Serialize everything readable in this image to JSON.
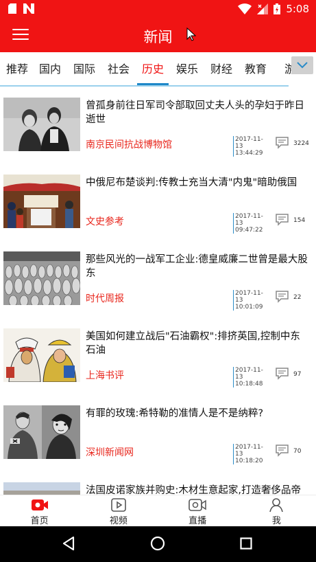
{
  "status_bar": {
    "time": "5:08",
    "icons": [
      "sd-card-icon",
      "notification-n-icon",
      "wifi-icon",
      "signal-icon",
      "battery-icon"
    ]
  },
  "app_bar": {
    "title": "新闻",
    "menu_icon": "hamburger-menu-icon"
  },
  "categories": {
    "items": [
      "推荐",
      "国内",
      "国际",
      "社会",
      "历史",
      "娱乐",
      "财经",
      "教育",
      "游"
    ],
    "active_index": 4,
    "more_icon": "chevron-down-icon",
    "accent_color": "#f01414",
    "indicator_color": "#1e88c8"
  },
  "news": [
    {
      "headline": "曾孤身前往日军司令部取回丈夫人头的孕妇于昨日逝世",
      "source": "南京民间抗战博物馆",
      "date": "2017-11-13",
      "time": "13:44:29",
      "comments": "3224"
    },
    {
      "headline": "中俄尼布楚谈判:传教士充当大清\"内鬼\"暗助俄国",
      "source": "文史参考",
      "date": "2017-11-13",
      "time": "09:47:22",
      "comments": "154"
    },
    {
      "headline": "那些风光的一战军工企业:德皇威廉二世曾是最大股东",
      "source": "时代周报",
      "date": "2017-11-13",
      "time": "10:01:09",
      "comments": "22"
    },
    {
      "headline": "美国如何建立战后\"石油霸权\":排挤英国,控制中东石油",
      "source": "上海书评",
      "date": "2017-11-13",
      "time": "10:18:48",
      "comments": "97"
    },
    {
      "headline": "有罪的玫瑰:希特勒的准情人是不是纳粹?",
      "source": "深圳新闻网",
      "date": "2017-11-13",
      "time": "10:18:20",
      "comments": "70"
    },
    {
      "headline": "法国皮诺家族并购史:木材生意起家,打造奢侈品帝",
      "source": "",
      "date": "",
      "time": "",
      "comments": ""
    }
  ],
  "bottom_nav": {
    "items": [
      {
        "label": "首页",
        "icon": "home-camera-icon",
        "active": true
      },
      {
        "label": "视频",
        "icon": "video-play-icon",
        "active": false
      },
      {
        "label": "直播",
        "icon": "live-camera-icon",
        "active": false
      },
      {
        "label": "我",
        "icon": "person-icon",
        "active": false
      }
    ],
    "active_color": "#f01414"
  },
  "system_nav": {
    "buttons": [
      "back-icon",
      "home-icon",
      "recents-icon"
    ]
  }
}
